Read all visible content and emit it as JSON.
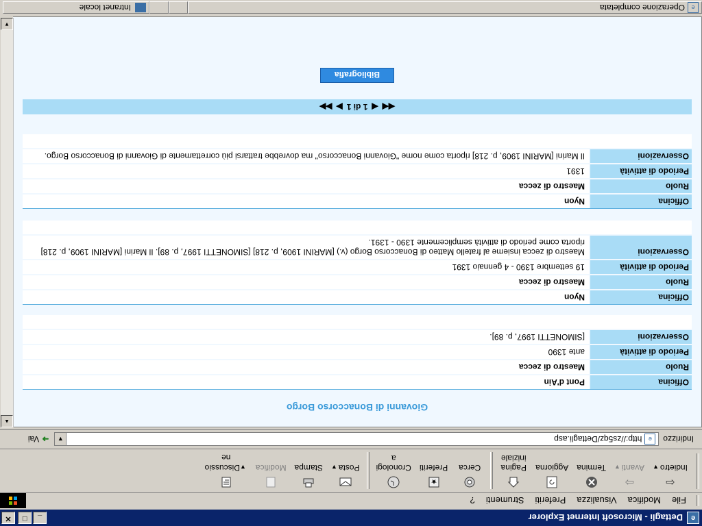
{
  "window": {
    "title": "Dettagli - Microsoft Internet Explorer",
    "controls": {
      "minimize": "_",
      "maximize": "□",
      "close": "✕"
    }
  },
  "menu": [
    "File",
    "Modifica",
    "Visualizza",
    "Preferiti",
    "Strumenti",
    "?"
  ],
  "toolbar": {
    "back": "Indietro",
    "forward": "Avanti",
    "stop": "Termina",
    "refresh": "Aggiorna",
    "home": [
      "Pagina",
      "iniziale"
    ],
    "search": "Cerca",
    "favorites": "Preferiti",
    "history": [
      "Cronologi",
      "a"
    ],
    "mail": "Posta",
    "print": "Stampa",
    "edit": "Modifica",
    "discuss": [
      "Discussio",
      "ne"
    ]
  },
  "address": {
    "label": "Indirizzo",
    "url": "http://zs5qz/Dettagli.asp",
    "go": "Vai"
  },
  "page": {
    "title": "Giovanni di Bonaccorso Borgo",
    "labels": {
      "officina": "Officina",
      "ruolo": "Ruolo",
      "periodo": "Periodo di attività",
      "osservazioni": "Osservazioni"
    },
    "records": [
      {
        "officina": "Pont d'Ain",
        "ruolo": "Maestro di zecca",
        "periodo": "ante 1390",
        "osservazioni": "[SIMONETTI 1997, p. 89]."
      },
      {
        "officina": "Nyon",
        "ruolo": "Maestro di zecca",
        "periodo": "19 settembre 1390 - 4 gennaio 1391",
        "osservazioni": "Maestro di zecca insieme al fratello Matteo di Bonaccorso Borgo (v.) [MARINI 1909, p. 218] [SIMONETTI 1997, p. 89]. Il Marini [MARINI 1909, p. 218] riporta come periodo di attività semplicemente 1390 - 1391."
      },
      {
        "officina": "Nyon",
        "ruolo": "Maestro di zecca",
        "periodo": "1391",
        "osservazioni": "Il Marini [MARINI 1909, p. 218] riporta come nome \"Giovanni Bonaccorso\" ma dovrebbe trattarsi più correttamente di Giovanni di Bonaccorso Borgo."
      }
    ],
    "pager": {
      "first": "◀◀",
      "prev": "◀",
      "text": "1 di 1",
      "next": "▶",
      "last": "▶▶"
    },
    "bibliography_button": "Bibliografia"
  },
  "status": {
    "text": "Operazione completata",
    "zone": "Intranet locale"
  }
}
